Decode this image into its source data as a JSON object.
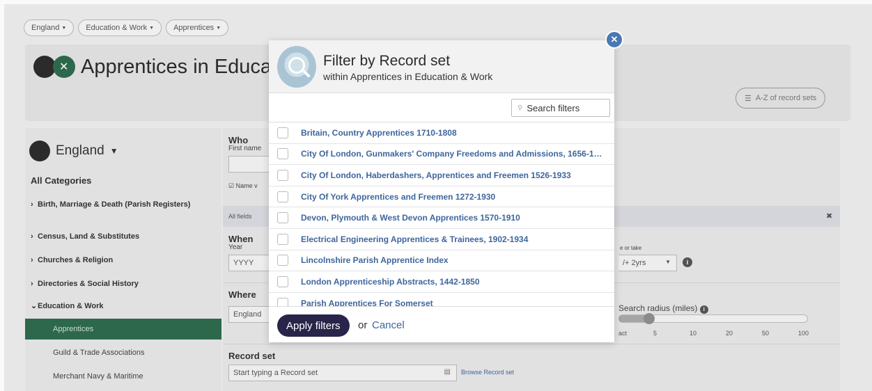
{
  "breadcrumbs": [
    {
      "label": "England"
    },
    {
      "label": "Education & Work"
    },
    {
      "label": "Apprentices"
    }
  ],
  "header": {
    "title": "Apprentices in Education & Work",
    "az_button": "A-Z of record sets"
  },
  "sidebar": {
    "region": "England",
    "all_categories": "All Categories",
    "categories": [
      "Birth, Marriage & Death (Parish Registers)",
      "Census, Land & Substitutes",
      "Churches & Religion",
      "Directories & Social History",
      "Education & Work"
    ],
    "subcategories": [
      "Apprentices",
      "Guild & Trade Associations",
      "Merchant Navy & Maritime"
    ]
  },
  "form": {
    "who_label": "Who",
    "first_name_label": "First name",
    "name_variants_label": "Name v",
    "all_fields_text": "All fields",
    "when_label": "When",
    "year_label": "Year",
    "year_placeholder": "YYYY",
    "give_or_take_label": "e or take",
    "give_or_take_value": "/+ 2yrs",
    "where_label": "Where",
    "where_value": "England",
    "search_radius_label": "Search radius (miles)",
    "radius_ticks": [
      "act",
      "5",
      "10",
      "20",
      "50",
      "100"
    ],
    "record_set_label": "Record set",
    "record_set_placeholder": "Start typing a Record set",
    "browse_link": "Browse Record set"
  },
  "modal": {
    "title": "Filter by Record set",
    "subtitle": "within Apprentices in Education & Work",
    "search_placeholder": "Search filters",
    "items": [
      "Britain, Country Apprentices 1710-1808",
      "City Of London, Gunmakers' Company Freedoms and Admissions, 1656-1…",
      "City Of London, Haberdashers, Apprentices and Freemen 1526-1933",
      "City Of York Apprentices and Freemen 1272-1930",
      "Devon, Plymouth & West Devon Apprentices 1570-1910",
      "Electrical Engineering Apprentices & Trainees, 1902-1934",
      "Lincolnshire Parish Apprentice Index",
      "London Apprenticeship Abstracts, 1442-1850",
      "Parish Apprentices For Somerset"
    ],
    "apply_label": "Apply filters",
    "or_text": "or",
    "cancel_label": "Cancel"
  }
}
